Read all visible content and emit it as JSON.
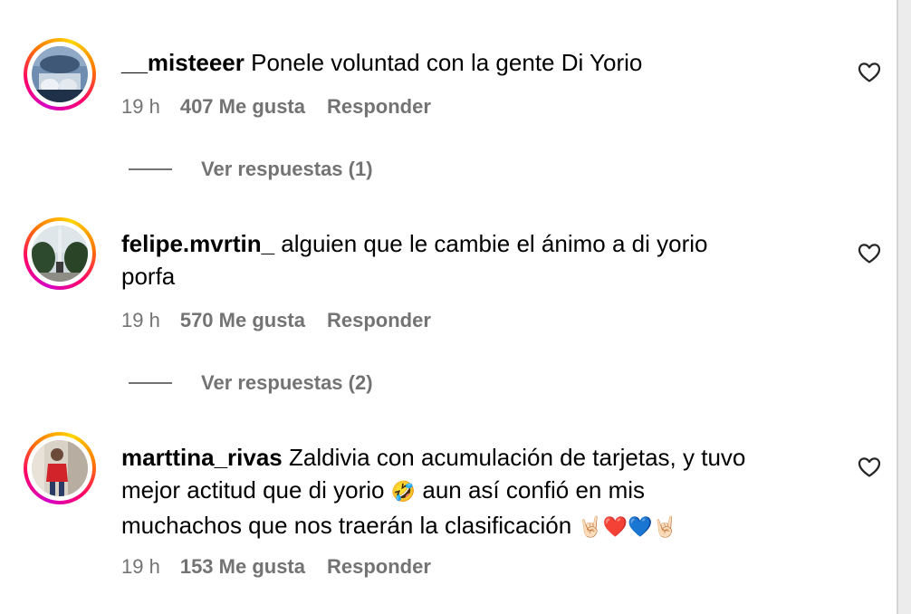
{
  "comments": [
    {
      "username": "__misteeer",
      "text": "Ponele voluntad con la gente Di Yorio",
      "time": "19 h",
      "likes": "407 Me gusta",
      "reply_label": "Responder",
      "view_replies": "Ver respuestas (1)"
    },
    {
      "username": "felipe.mvrtin_",
      "text_line1": "alguien que le cambie el ánimo a di yorio",
      "text_line2": "porfa",
      "time": "19 h",
      "likes": "570 Me gusta",
      "reply_label": "Responder",
      "view_replies": "Ver respuestas (2)"
    },
    {
      "username": "marttina_rivas",
      "text_line1": "Zaldivia con acumulación de tarjetas, y tuvo",
      "text_line2a": "mejor actitud que di yorio",
      "emoji_laugh": "🤣",
      "text_line2b": "aun así confió en mis",
      "text_line3": "muchachos que nos traerán la clasificación",
      "emoji_trail": "🤘🏻❤️💙🤘🏻",
      "time": "19 h",
      "likes": "153 Me gusta",
      "reply_label": "Responder"
    }
  ],
  "colors": {
    "meta_gray": "#737373",
    "text": "#000000",
    "story_ring": [
      "#d300c5",
      "#ff0069",
      "#ff7a00",
      "#ffd600"
    ]
  },
  "icons": {
    "like": "heart-outline-icon"
  }
}
